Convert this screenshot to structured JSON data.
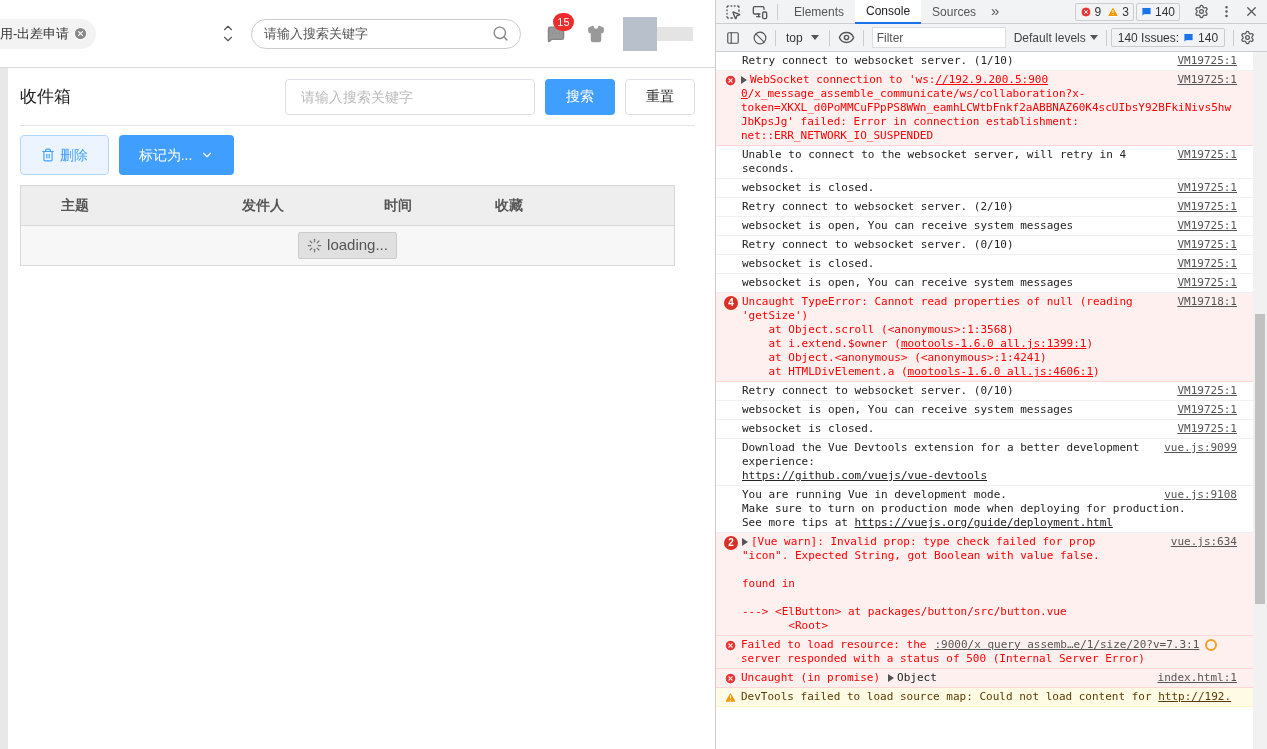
{
  "header": {
    "tag": {
      "label": "用-出差申请"
    },
    "search": {
      "placeholder": "请输入搜索关键字"
    },
    "notifications": {
      "count": "15"
    }
  },
  "inbox": {
    "title": "收件箱",
    "search": {
      "placeholder": "请输入搜索关键字"
    },
    "search_button": "搜索",
    "reset_button": "重置",
    "delete_button": "删除",
    "mark_button": "标记为...",
    "table": {
      "columns": [
        "主题",
        "发件人",
        "时间",
        "收藏"
      ],
      "loading": "loading..."
    }
  },
  "devtools": {
    "tabs": [
      {
        "label": "Elements",
        "selected": false
      },
      {
        "label": "Console",
        "selected": true
      },
      {
        "label": "Sources",
        "selected": false
      }
    ],
    "more": "»",
    "counts": {
      "errors": "9",
      "warnings": "3",
      "messages": "140"
    },
    "context": "top",
    "filter": {
      "placeholder": "Filter"
    },
    "levels": "Default levels",
    "issues": {
      "label": "140 Issues:",
      "count": "140"
    },
    "messages": [
      {
        "kind": "info",
        "source": "VM19725:1",
        "lines": [
          {
            "text": "Retry connect to websocket server. (1/10)"
          }
        ]
      },
      {
        "kind": "error",
        "expandable": true,
        "source": "VM19725:1",
        "lines": [
          {
            "text": "WebSocket connection to 'ws:",
            "link": "//192.9.200.5:900"
          },
          {
            "link": "0",
            "tail": "/x_message_assemble_communicate/ws/collaboration?x-"
          },
          {
            "text": "token=XKXL_d0PoMMCuFPpPS8WWn_eamhLCWtbFnkf2aABBNAZ60K4scUIbsY92BFkiNivs5hw"
          },
          {
            "text": "JbKpsJg' failed: Error in connection establishment:"
          },
          {
            "text": "net::ERR_NETWORK_IO_SUSPENDED"
          }
        ]
      },
      {
        "kind": "info",
        "source": "VM19725:1",
        "lines": [
          {
            "text": "Unable to connect to the websocket server, will retry in 4"
          },
          {
            "text": "seconds."
          }
        ]
      },
      {
        "kind": "info",
        "source": "VM19725:1",
        "lines": [
          {
            "text": "websocket is closed."
          }
        ]
      },
      {
        "kind": "info",
        "source": "VM19725:1",
        "lines": [
          {
            "text": "Retry connect to websocket server. (2/10)"
          }
        ]
      },
      {
        "kind": "info",
        "source": "VM19725:1",
        "lines": [
          {
            "text": "websocket is open, You can receive system messages"
          }
        ]
      },
      {
        "kind": "info",
        "source": "VM19725:1",
        "lines": [
          {
            "text": "Retry connect to websocket server. (0/10)"
          }
        ]
      },
      {
        "kind": "info",
        "source": "VM19725:1",
        "lines": [
          {
            "text": "websocket is closed."
          }
        ]
      },
      {
        "kind": "info",
        "source": "VM19725:1",
        "lines": [
          {
            "text": "websocket is open, You can receive system messages"
          }
        ]
      },
      {
        "kind": "error",
        "count": "4",
        "source": "VM19718:1",
        "lines": [
          {
            "text": "Uncaught TypeError: Cannot read properties of null (reading"
          },
          {
            "text": "'getSize')"
          },
          {
            "text": "    at Object.scroll (<anonymous>:1:3568)"
          },
          {
            "text": "    at i.extend.$owner (",
            "link": "mootools-1.6.0 all.js:1399:1",
            "tail": ")"
          },
          {
            "text": "    at Object.<anonymous> (<anonymous>:1:4241)"
          },
          {
            "text": "    at HTMLDivElement.a (",
            "link": "mootools-1.6.0 all.js:4606:1",
            "tail": ")"
          }
        ]
      },
      {
        "kind": "info",
        "source": "VM19725:1",
        "lines": [
          {
            "text": "Retry connect to websocket server. (0/10)"
          }
        ]
      },
      {
        "kind": "info",
        "source": "VM19725:1",
        "lines": [
          {
            "text": "websocket is open, You can receive system messages"
          }
        ]
      },
      {
        "kind": "info",
        "source": "VM19725:1",
        "lines": [
          {
            "text": "websocket is closed."
          }
        ]
      },
      {
        "kind": "info",
        "source": "vue.js:9099",
        "lines": [
          {
            "text": "Download the Vue Devtools extension for a better development"
          },
          {
            "text": "experience:"
          },
          {
            "link": "https://github.com/vuejs/vue-devtools"
          }
        ]
      },
      {
        "kind": "info",
        "source": "vue.js:9108",
        "lines": [
          {
            "text": "You are running Vue in development mode."
          },
          {
            "text": "Make sure to turn on production mode when deploying for production."
          },
          {
            "text": "See more tips at ",
            "link": "https://vuejs.org/guide/deployment.html"
          }
        ]
      },
      {
        "kind": "error",
        "count": "2",
        "expandable": true,
        "source": "vue.js:634",
        "lines": [
          {
            "text": "[Vue warn]: Invalid prop: type check failed for prop"
          },
          {
            "text": "\"icon\". Expected String, got Boolean with value false."
          },
          {
            "text": "found in",
            "spaced": true
          },
          {
            "text": "---> <ElButton> at packages/button/src/button.vue",
            "spaced": true
          },
          {
            "text": "       <Root>"
          }
        ]
      },
      {
        "kind": "error",
        "inline_source": true,
        "source": ":9000/x query assemb…e/1/size/20?v=7.3:1",
        "lines": [
          {
            "text": "Failed to load resource: the"
          },
          {
            "text": "server responded with a status of 500 (Internal Server Error)"
          }
        ]
      },
      {
        "kind": "error",
        "object": "Object",
        "source": "index.html:1",
        "lines": [
          {
            "text": "Uncaught (in promise)"
          }
        ]
      },
      {
        "kind": "warning",
        "lines": [
          {
            "text": "DevTools failed to load source map: Could not load content for ",
            "link": "http://192."
          }
        ]
      }
    ]
  }
}
